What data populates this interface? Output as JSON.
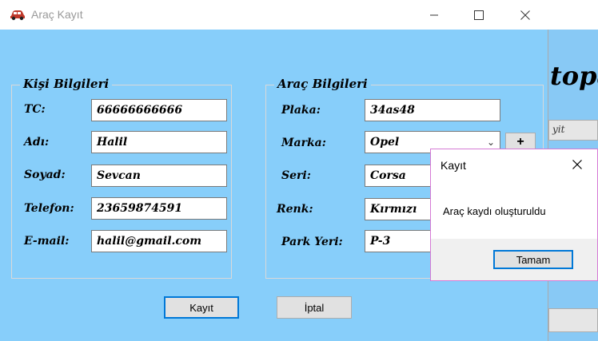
{
  "window": {
    "title": "Araç Kayıt"
  },
  "titlebar": {
    "minimize": "—",
    "maximize": "☐",
    "close": "✕"
  },
  "person_group": {
    "legend": "Kişi Bilgileri",
    "fields": [
      {
        "label": "TC:",
        "value": "66666666666"
      },
      {
        "label": "Adı:",
        "value": "Halil"
      },
      {
        "label": "Soyad:",
        "value": "Sevcan"
      },
      {
        "label": "Telefon:",
        "value": "23659874591"
      },
      {
        "label": "E-mail:",
        "value": "halil@gmail.com"
      }
    ]
  },
  "vehicle_group": {
    "legend": "Araç Bilgileri",
    "fields": [
      {
        "label": "Plaka:",
        "value": "34as48"
      },
      {
        "label": "Marka:",
        "value": "Opel"
      },
      {
        "label": "Seri:",
        "value": "Corsa"
      },
      {
        "label": "Renk:",
        "value": "Kırmızı"
      },
      {
        "label": "Park Yeri:",
        "value": "P-3"
      }
    ],
    "add_button": "+"
  },
  "buttons": {
    "save": "Kayıt",
    "cancel": "İptal"
  },
  "dialog": {
    "title": "Kayıt",
    "message": "Araç kaydı oluşturuldu",
    "ok": "Tamam"
  },
  "background_window": {
    "heading": "topa",
    "button_fragment": "yit"
  },
  "colors": {
    "form_bg": "#87cefa",
    "accent": "#0078d7",
    "dialog_border": "#d57ad5"
  }
}
